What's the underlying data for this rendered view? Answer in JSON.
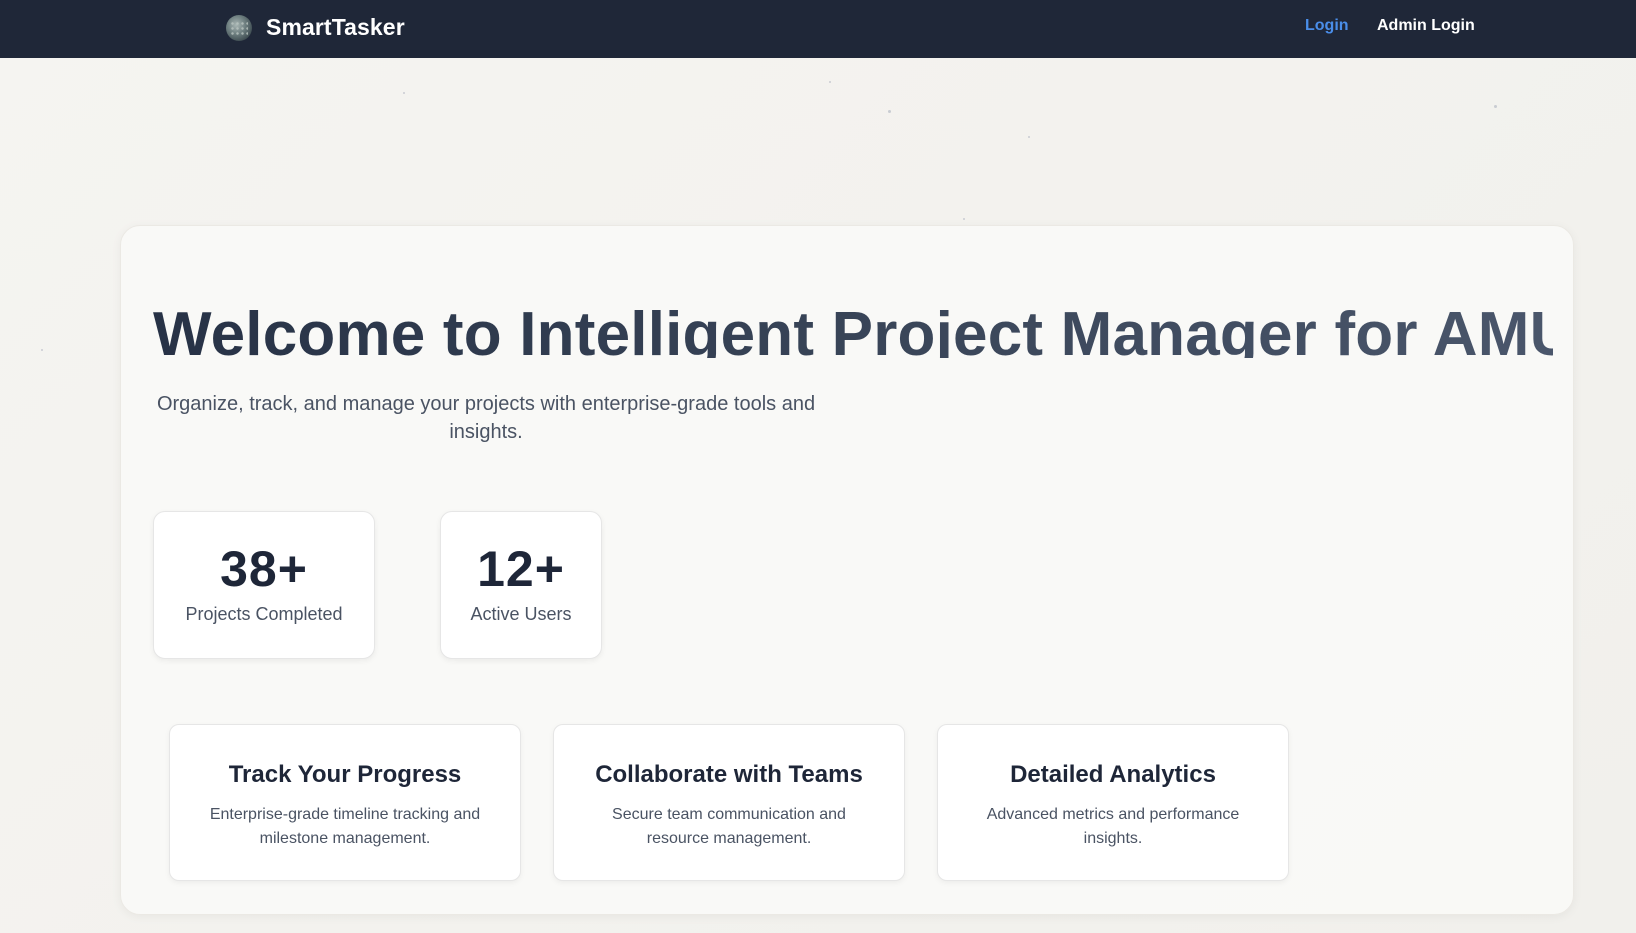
{
  "navbar": {
    "brand_name": "SmartTasker",
    "logo_icon": "globe-logo-icon",
    "login_label": "Login",
    "admin_login_label": "Admin Login",
    "login_color": "#4a8eea",
    "background_color": "#1f2738"
  },
  "hero": {
    "title": "Welcome to Intelligent Project Manager for AMU",
    "subtitle": "Organize, track, and manage your projects with enterprise-grade tools and insights."
  },
  "stats": [
    {
      "value": "38+",
      "label": "Projects Completed"
    },
    {
      "value": "12+",
      "label": "Active Users"
    }
  ],
  "features": [
    {
      "title": "Track Your Progress",
      "description": "Enterprise-grade timeline tracking and milestone management."
    },
    {
      "title": "Collaborate with Teams",
      "description": "Secure team communication and resource management."
    },
    {
      "title": "Detailed Analytics",
      "description": "Advanced metrics and performance insights."
    }
  ]
}
